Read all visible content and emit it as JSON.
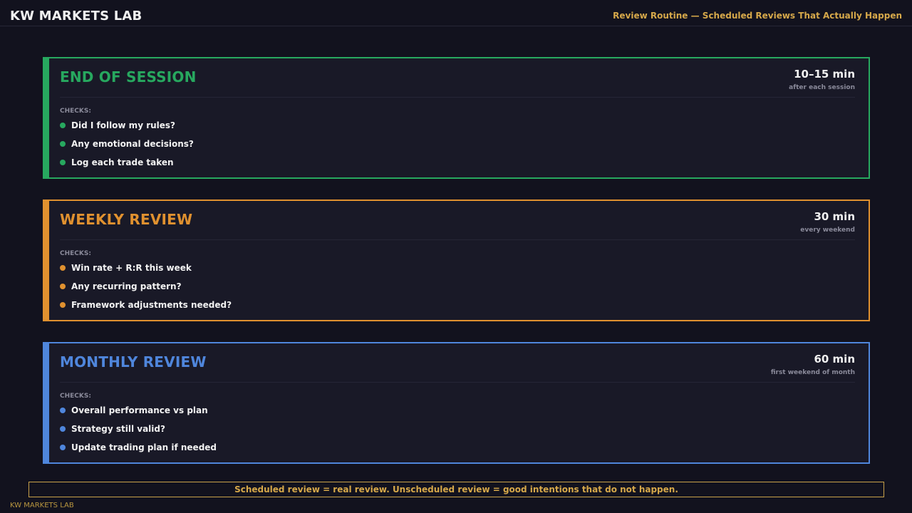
{
  "header": {
    "brand": "KW MARKETS LAB",
    "tagline": "Review Routine — Scheduled Reviews That Actually Happen"
  },
  "checks_label": "CHECKS:",
  "reviews": [
    {
      "title": "END OF SESSION",
      "time": "10–15 min",
      "frequency": "after each session",
      "color": "#27a85f",
      "checks": [
        "Did I follow my rules?",
        "Any emotional decisions?",
        "Log each trade taken"
      ]
    },
    {
      "title": "WEEKLY REVIEW",
      "time": "30 min",
      "frequency": "every weekend",
      "color": "#e0912f",
      "checks": [
        "Win rate + R:R this week",
        "Any recurring pattern?",
        "Framework adjustments needed?"
      ]
    },
    {
      "title": "MONTHLY REVIEW",
      "time": "60 min",
      "frequency": "first weekend of month",
      "color": "#4f86dc",
      "checks": [
        "Overall performance vs plan",
        "Strategy still valid?",
        "Update trading plan if needed"
      ]
    }
  ],
  "footer": {
    "message": "Scheduled review = real review. Unscheduled review = good intentions that do not happen.",
    "brand": "KW MARKETS LAB"
  }
}
